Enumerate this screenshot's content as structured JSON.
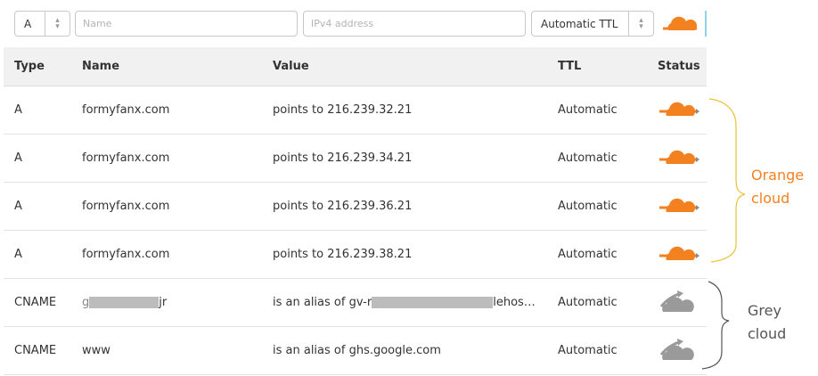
{
  "toolbar": {
    "type_value": "A",
    "name_placeholder": "Name",
    "ip_placeholder": "IPv4 address",
    "ttl_value": "Automatic TTL"
  },
  "columns": [
    "Type",
    "Name",
    "Value",
    "TTL",
    "Status"
  ],
  "records": [
    {
      "type": "A",
      "name": "formyfanx.com",
      "value": "points to 216.239.32.21",
      "ttl": "Automatic",
      "status": "orange-cloud"
    },
    {
      "type": "A",
      "name": "formyfanx.com",
      "value": "points to 216.239.34.21",
      "ttl": "Automatic",
      "status": "orange-cloud"
    },
    {
      "type": "A",
      "name": "formyfanx.com",
      "value": "points to 216.239.36.21",
      "ttl": "Automatic",
      "status": "orange-cloud"
    },
    {
      "type": "A",
      "name": "formyfanx.com",
      "value": "points to 216.239.38.21",
      "ttl": "Automatic",
      "status": "orange-cloud"
    },
    {
      "type": "CNAME",
      "name_prefix": "g",
      "name_suffix": "jr",
      "value_prefix": "is an alias of gv-r",
      "value_suffix": "lehos…",
      "ttl": "Automatic",
      "status": "grey-cloud"
    },
    {
      "type": "CNAME",
      "name": "www",
      "value": "is an alias of ghs.google.com",
      "ttl": "Automatic",
      "status": "grey-cloud"
    }
  ],
  "annotations": {
    "orange_line1": "Orange",
    "orange_line2": "cloud",
    "grey_line1": "Grey",
    "grey_line2": "cloud"
  },
  "colors": {
    "orange": "#f48120",
    "grey_cloud": "#9a9a9a",
    "bracket_orange": "#e8c234",
    "bracket_grey": "#555555"
  }
}
